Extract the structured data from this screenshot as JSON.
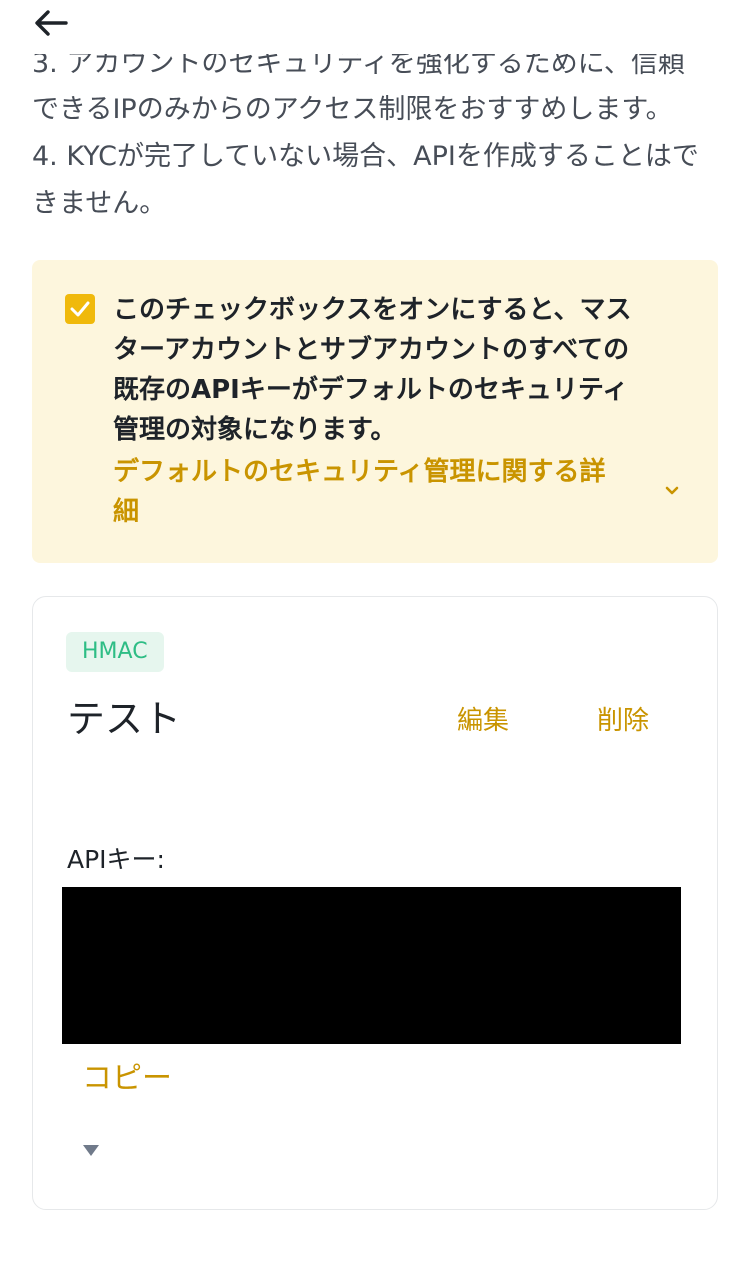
{
  "header": {
    "back_icon": "arrow-left-icon"
  },
  "notes": {
    "item3_line1": "3. アカウントのセキュリティを強化するために、信頼",
    "item3_line2": "できるIPのみからのアクセス制限をおすすめします。",
    "item4_line1": "4. KYCが完了していない場合、APIを作成することはで",
    "item4_line2": "きません。"
  },
  "notice": {
    "checked": true,
    "text_line1": "このチェックボックスをオンにすると、マス",
    "text_line2": "ターアカウントとサブアカウントのすべての",
    "text_line3": "既存のAPIキーがデフォルトのセキュリティ",
    "text_line4": "管理の対象になります。",
    "link_line1": "デフォルトのセキュリティ管理に関する詳",
    "link_line2": "細",
    "accent_color": "#f0b90b",
    "background_color": "#fdf6dd"
  },
  "api_card": {
    "tag": "HMAC",
    "name": "テスト",
    "edit_label": "編集",
    "delete_label": "削除",
    "api_key_label": "APIキー:",
    "api_key_value": "",
    "copy_label": "コピー",
    "link_color": "#c99400"
  }
}
